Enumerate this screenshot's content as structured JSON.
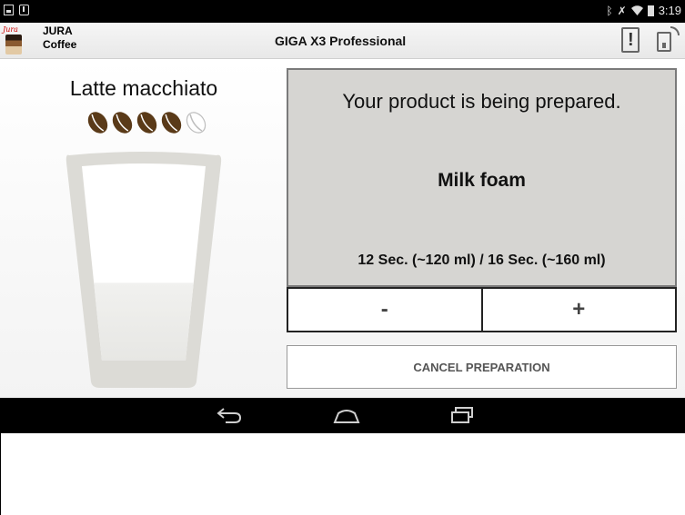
{
  "status_bar": {
    "time": "3:19",
    "icons": [
      "notification-icon",
      "download-icon",
      "bluetooth-icon",
      "mute-icon",
      "wifi-icon",
      "battery-icon"
    ]
  },
  "app_bar": {
    "logo_text": "Jura",
    "app_name": "JURA",
    "app_subtitle": "Coffee",
    "machine_title": "GIGA X3 Professional",
    "alert_label": "!"
  },
  "product": {
    "name": "Latte macchiato",
    "strength": {
      "filled": 4,
      "total": 5
    },
    "glass_fill_fraction": 0.4
  },
  "preparation": {
    "status": "Your product is being prepared.",
    "step": "Milk foam",
    "amount": "12 Sec. (~120 ml) / 16 Sec. (~160 ml)",
    "minus_label": "-",
    "plus_label": "+",
    "cancel_label": "CANCEL PREPARATION"
  },
  "nav_bar": {
    "icons": [
      "back-icon",
      "home-icon",
      "recent-apps-icon"
    ]
  },
  "colors": {
    "panel_bg": "#d6d5d2",
    "bean_filled": "#5a3a18",
    "bean_empty": "#ffffff",
    "glass": "#dcdbd6"
  }
}
